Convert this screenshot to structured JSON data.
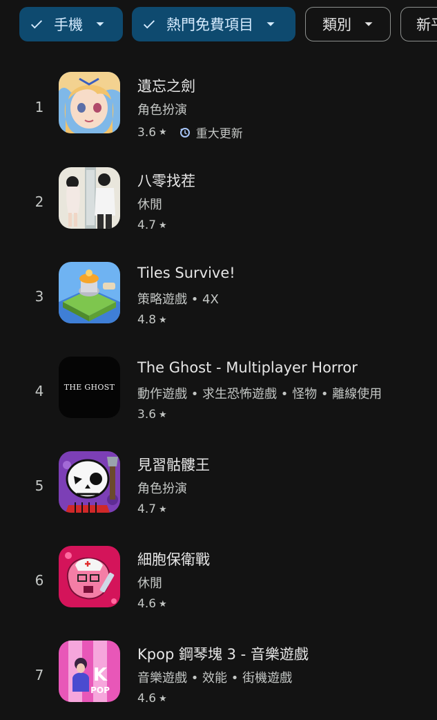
{
  "filters": [
    {
      "label": "手機",
      "selected": true
    },
    {
      "label": "熱門免費項目",
      "selected": true
    },
    {
      "label": "類別",
      "selected": false
    },
    {
      "label": "新平",
      "selected": false
    }
  ],
  "apps": [
    {
      "rank": "1",
      "name": "遺忘之劍",
      "category": "角色扮演",
      "rating": "3.6",
      "badge": "重大更新",
      "icon": "anime-girl-icon"
    },
    {
      "rank": "2",
      "name": "八零找茬",
      "category": "休閒",
      "rating": "4.7",
      "icon": "two-characters-icon"
    },
    {
      "rank": "3",
      "name": "Tiles Survive!",
      "category": "策略遊戲 • 4X",
      "rating": "4.8",
      "icon": "tower-island-icon"
    },
    {
      "rank": "4",
      "name": "The Ghost - Multiplayer Horror",
      "category": "動作遊戲 • 求生恐怖遊戲 • 怪物 • 離線使用",
      "rating": "3.6",
      "icon": "the-ghost-logo-icon",
      "icon_text": "THE GHOST"
    },
    {
      "rank": "5",
      "name": "見習骷髏王",
      "category": "角色扮演",
      "rating": "4.7",
      "icon": "skeleton-icon"
    },
    {
      "rank": "6",
      "name": "細胞保衛戰",
      "category": "休閒",
      "rating": "4.6",
      "icon": "pink-cell-nurse-icon"
    },
    {
      "rank": "7",
      "name": "Kpop 鋼琴塊 3 - 音樂遊戲",
      "category": "音樂遊戲 • 效能 • 街機遊戲",
      "rating": "4.6",
      "icon": "kpop-piano-icon",
      "icon_text": "K"
    }
  ],
  "colors": {
    "background": "#131313",
    "chip_selected": "#0e4a6f",
    "accent_update": "#a8c7fa"
  }
}
